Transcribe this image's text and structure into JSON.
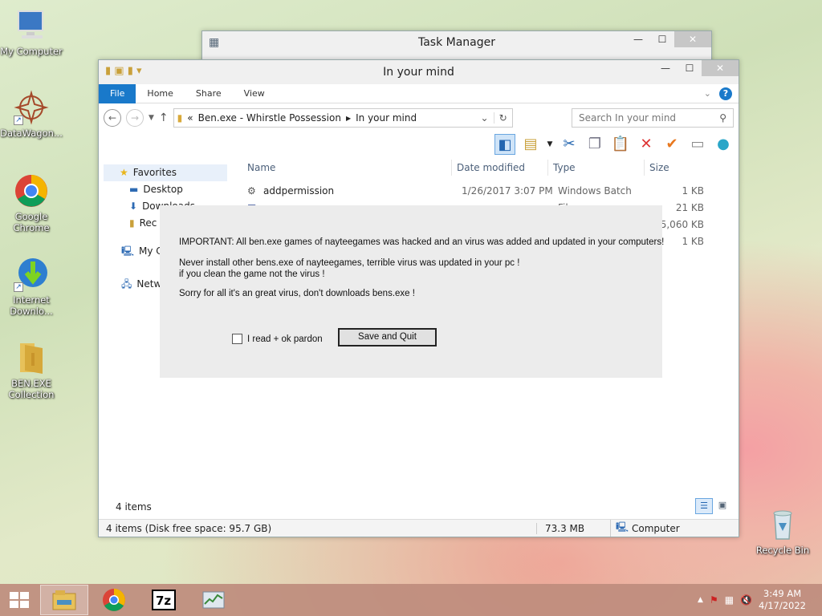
{
  "desktop": {
    "icons": [
      {
        "label": "My Computer"
      },
      {
        "label": "DataWagon..."
      },
      {
        "label": "Google Chrome"
      },
      {
        "label": "Internet Downlo..."
      },
      {
        "label": "BEN.EXE Collection"
      },
      {
        "label": "Recycle Bin"
      }
    ]
  },
  "task_manager": {
    "title": "Task Manager"
  },
  "explorer": {
    "title": "In your mind",
    "ribbon_tabs": [
      "File",
      "Home",
      "Share",
      "View"
    ],
    "breadcrumb": [
      "«",
      "Ben.exe - Whirstle Possession",
      "In your mind"
    ],
    "search_placeholder": "Search In your mind",
    "nav": {
      "favorites": "Favorites",
      "desktop": "Desktop",
      "downloads": "Downloads",
      "recent": "Rec",
      "computer": "My C",
      "network": "Netw"
    },
    "columns": [
      "Name",
      "Date modified",
      "Type",
      "Size"
    ],
    "rows": [
      {
        "name": "addpermission",
        "date": "1/26/2017 3:07 PM",
        "type": "Windows Batch File",
        "size": "1 KB"
      },
      {
        "name": "",
        "date": "",
        "type": "",
        "size": "21 KB"
      },
      {
        "name": "",
        "date": "",
        "type": "",
        "size": "75,060 KB"
      },
      {
        "name": "",
        "date": "",
        "type": "",
        "size": "1 KB"
      }
    ],
    "item_count": "4 items",
    "status_left": "4 items (Disk free space: 95.7 GB)",
    "status_size": "73.3 MB",
    "status_location": "Computer"
  },
  "dialog": {
    "line1": "IMPORTANT: All ben.exe games of nayteegames was hacked and an virus was added and updated in your computers!",
    "line2": "Never install other bens.exe of nayteegames, terrible virus was updated in your pc !",
    "line3": "if you clean the game not the virus !",
    "line4": "Sorry for all it's an great virus, don't downloads bens.exe !",
    "checkbox_label": "I read +  ok pardon",
    "button_label": "Save and Quit"
  },
  "taskbar": {
    "time": "3:49 AM",
    "date": "4/17/2022"
  },
  "colors": {
    "file_tab": "#1979ca",
    "taskbar": "#be8c7d",
    "dialog_bg": "#ececec"
  }
}
